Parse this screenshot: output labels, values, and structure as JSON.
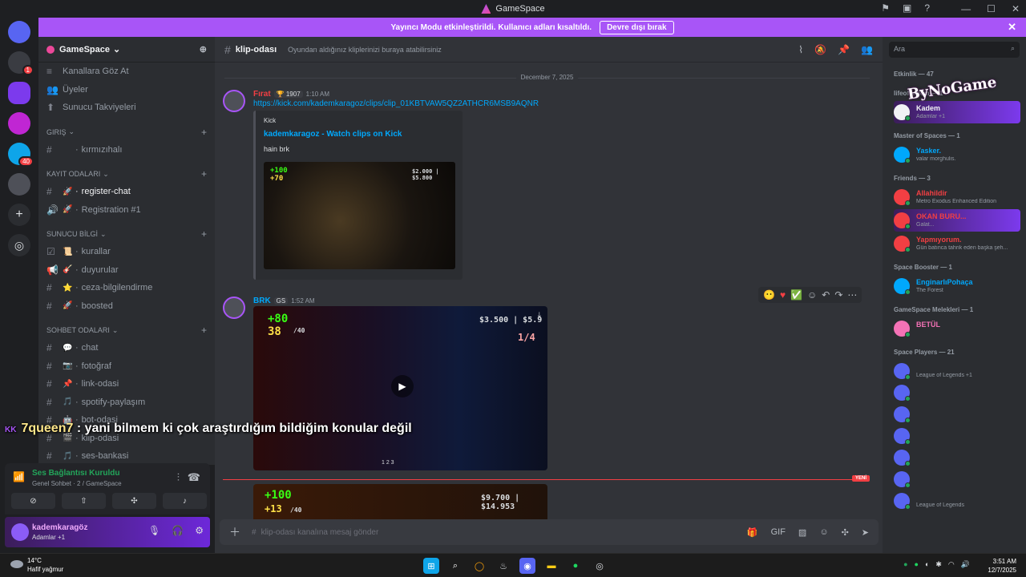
{
  "window": {
    "title": "GameSpace"
  },
  "banner": {
    "text": "Yayıncı Modu etkinleştirildi. Kullanıcı adları kısaltıldı.",
    "button": "Devre dışı bırak"
  },
  "server": {
    "name": "GameSpace"
  },
  "channels": {
    "top": [
      {
        "icon": "≡",
        "label": "Kanallara Göz At"
      },
      {
        "icon": "👥",
        "label": "Üyeler"
      },
      {
        "icon": "⬆",
        "label": "Sunucu Takviyeleri"
      }
    ],
    "categories": [
      {
        "name": "Giriş",
        "items": [
          {
            "icon": "#",
            "emoji": "",
            "label": "kırmızıhalı"
          }
        ]
      },
      {
        "name": "Kayıt Odaları",
        "items": [
          {
            "icon": "#",
            "emoji": "🚀",
            "label": "register-chat",
            "active": true
          },
          {
            "icon": "🔊",
            "emoji": "🚀",
            "label": "Registration #1"
          }
        ]
      },
      {
        "name": "SUNUCU BİLGİ",
        "items": [
          {
            "icon": "☑",
            "emoji": "📜",
            "label": "kurallar"
          },
          {
            "icon": "📢",
            "emoji": "🎸",
            "label": "duyurular"
          },
          {
            "icon": "#",
            "emoji": "⭐",
            "label": "ceza-bilgilendirme"
          },
          {
            "icon": "#",
            "emoji": "🚀",
            "label": "boosted"
          }
        ]
      },
      {
        "name": "SOHBET ODALARI",
        "items": [
          {
            "icon": "#",
            "emoji": "💬",
            "label": "chat"
          },
          {
            "icon": "#",
            "emoji": "📷",
            "label": "fotoğraf"
          },
          {
            "icon": "#",
            "emoji": "📌",
            "label": "link-odasi"
          },
          {
            "icon": "#",
            "emoji": "🎵",
            "label": "spotify-paylaşım"
          },
          {
            "icon": "#",
            "emoji": "🤖",
            "label": "bot-odasi"
          },
          {
            "icon": "#",
            "emoji": "🎬",
            "label": "klip-odasi"
          },
          {
            "icon": "#",
            "emoji": "🎵",
            "label": "ses-bankasi"
          }
        ]
      }
    ]
  },
  "voice": {
    "status": "Ses Bağlantısı Kuruldu",
    "channel": "Genel Sohbet",
    "server": "2 / GameSpace"
  },
  "user": {
    "name": "kademkaragöz",
    "status": "Adamlar +1"
  },
  "channel_header": {
    "name": "klip-odası",
    "topic": "Oyundan aldığınız kliplerinizi buraya atabilirsiniz"
  },
  "date_divider": "December 7, 2025",
  "messages": [
    {
      "user": "Fırat",
      "tag": "🏆 1907",
      "time": "1:10 AM",
      "link": "https://kick.com/kademkaragoz/clips/clip_01KBTVAW5QZ2ATHCR6MSB9AQNR",
      "embed": {
        "provider": "Kick",
        "title": "kademkaragoz - Watch clips on Kick",
        "desc": "hain brk"
      }
    },
    {
      "user": "BRK",
      "tag": "GS",
      "time": "1:52 AM"
    }
  ],
  "hud": {
    "embed_hp": "+100",
    "embed_armor": "+70",
    "embed_money": "$2.000 | $5.800",
    "video_hp": "+80",
    "video_armor": "38",
    "video_sub": "/40",
    "video_money": "$3.500 | $5.9",
    "video_round": "1/4",
    "video_pages": "1   2   3",
    "video2_hp": "+100",
    "video2_armor": "+13",
    "video2_sub": "/40",
    "video2_money": "$9.700 | $14.953"
  },
  "new_label": "YENİ",
  "composer": {
    "placeholder": "klip-odası kanalına mesaj gönder"
  },
  "search": {
    "placeholder": "Ara"
  },
  "members": {
    "activity_label": "Etkinlik — 47",
    "groups": [
      {
        "title": "lifeofkadem — 1",
        "members": [
          {
            "name": "Kadem",
            "act": "Adamlar +1",
            "color": "#f2f3f5",
            "hl": true
          }
        ]
      },
      {
        "title": "Master of Spaces — 1",
        "members": [
          {
            "name": "Yasker.",
            "act": "valar morghulis.",
            "color": "#00a8fc"
          }
        ]
      },
      {
        "title": "Friends — 3",
        "members": [
          {
            "name": "Allahildir",
            "act": "Metro Exodus Enhanced Edition",
            "color": "#f23f43"
          },
          {
            "name": "OKAN BURU...",
            "act": "Galat...",
            "color": "#f23f43",
            "hl": true
          },
          {
            "name": "Yapmıyorum.",
            "act": "Gün batınca tahrik eden başka şeh...",
            "color": "#f23f43"
          }
        ]
      },
      {
        "title": "Space Booster — 1",
        "members": [
          {
            "name": "EnginarlıPohaça",
            "act": "The Forest",
            "color": "#00a8fc"
          }
        ]
      },
      {
        "title": "GameSpace Melekleri — 1",
        "members": [
          {
            "name": "BETÜL",
            "act": "",
            "color": "#f472b6"
          }
        ]
      },
      {
        "title": "Space Players — 21",
        "members": [
          {
            "name": "",
            "act": "League of Legends +1",
            "color": "#5865f2"
          },
          {
            "name": "",
            "act": "",
            "color": "#5865f2"
          },
          {
            "name": "",
            "act": "",
            "color": "#5865f2"
          },
          {
            "name": "",
            "act": "",
            "color": "#5865f2"
          },
          {
            "name": "",
            "act": "",
            "color": "#5865f2"
          },
          {
            "name": "",
            "act": "",
            "color": "#5865f2"
          },
          {
            "name": "",
            "act": "League of Legends",
            "color": "#5865f2"
          }
        ]
      }
    ]
  },
  "watermark": "ByNoGame",
  "overlay": {
    "prefix": "KK",
    "nick": "7queen7",
    "text": ": yani bilmem ki çok araştırdığım bildiğim konular değil"
  },
  "taskbar": {
    "temp": "14°C",
    "weather": "Hafif yağmur",
    "time": "3:51 AM",
    "date": "12/7/2025"
  }
}
